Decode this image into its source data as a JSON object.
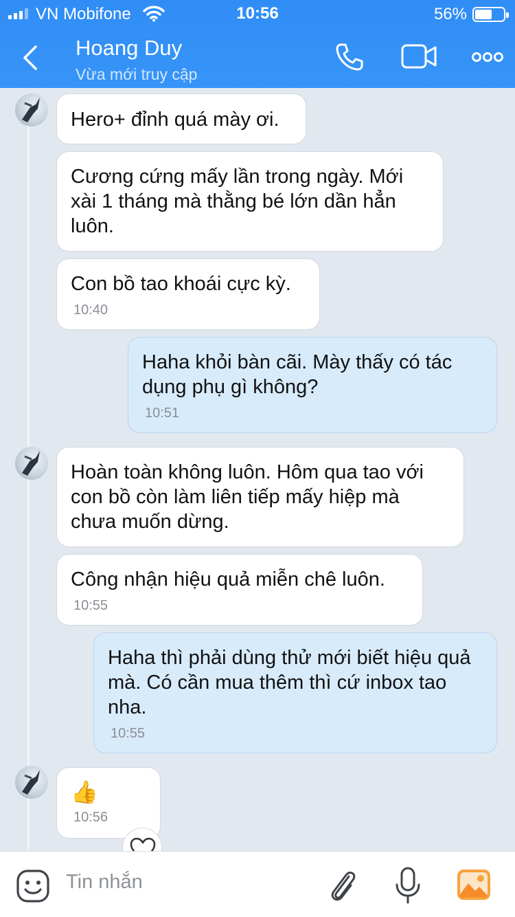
{
  "status_bar": {
    "carrier": "VN Mobifone",
    "time": "10:56",
    "battery": "56%"
  },
  "header": {
    "title": "Hoang Duy",
    "subtitle": "Vừa mới truy cập",
    "icons": [
      "back-icon",
      "phone-icon",
      "video-call-icon",
      "more-icon"
    ]
  },
  "messages": [
    {
      "side": "in",
      "text": "Hero+ đỉnh quá mày ơi.",
      "time": ""
    },
    {
      "side": "in",
      "text": "Cương cứng mấy lần trong ngày. Mới xài 1 tháng mà thằng bé lớn dần hẳn luôn.",
      "time": ""
    },
    {
      "side": "in",
      "text": "Con bồ tao khoái cực kỳ.",
      "time": "10:40"
    },
    {
      "side": "out",
      "text": "Haha khỏi bàn cãi. Mày thấy có tác dụng phụ gì không?",
      "time": "10:51"
    },
    {
      "side": "in",
      "text": "Hoàn toàn không luôn. Hôm qua tao với con bồ còn làm liên tiếp mấy hiệp mà chưa muốn dừng.",
      "time": ""
    },
    {
      "side": "in",
      "text": "Công nhận hiệu quả miễn chê luôn.",
      "time": "10:55"
    },
    {
      "side": "out",
      "text": "Haha thì phải dùng thử mới biết hiệu quả mà. Có cần mua thêm thì cứ inbox tao nha.",
      "time": "10:55"
    },
    {
      "side": "in",
      "text": "👍",
      "time": "10:56"
    }
  ],
  "input": {
    "placeholder": "Tin nhắn"
  }
}
